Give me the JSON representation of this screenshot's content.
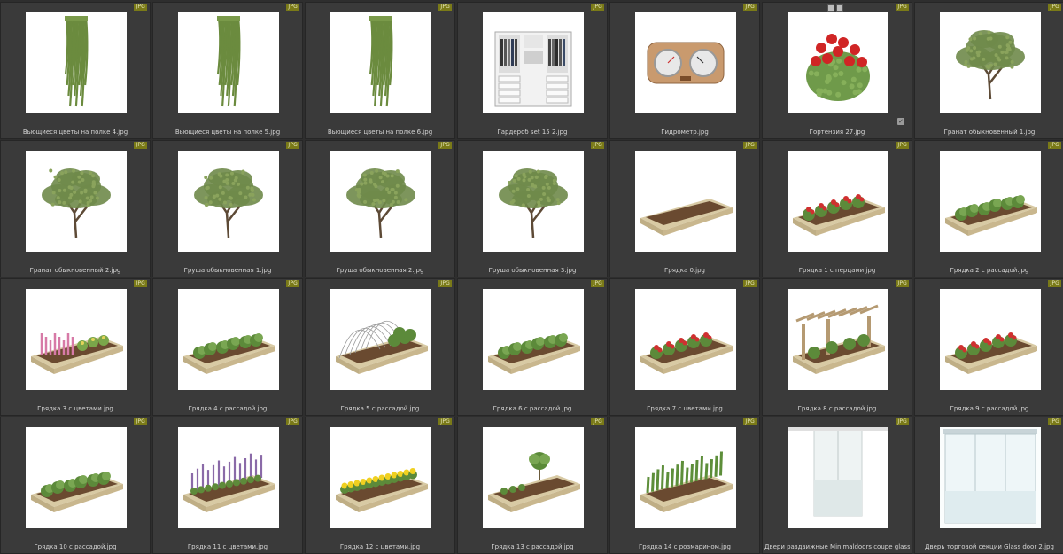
{
  "colors": {
    "background": "#2e2e2e",
    "cell": "#3a3a3a",
    "badge": "#7a7a18",
    "caption": "#d4d4d4"
  },
  "files": [
    {
      "name": "Вьющиеся цветы на полке 4.jpg",
      "badge": "JPG",
      "thumb": "hanging"
    },
    {
      "name": "Вьющиеся цветы на полке 5.jpg",
      "badge": "JPG",
      "thumb": "hanging"
    },
    {
      "name": "Вьющиеся цветы на полке 6.jpg",
      "badge": "JPG",
      "thumb": "hanging"
    },
    {
      "name": "Гардероб set 15 2.jpg",
      "badge": "JPG",
      "thumb": "wardrobe"
    },
    {
      "name": "Гидрометр.jpg",
      "badge": "JPG",
      "thumb": "hygrometer"
    },
    {
      "name": "Гортензия 27.jpg",
      "badge": "JPG",
      "thumb": "roses"
    },
    {
      "name": "Гранат обыкновенный 1.jpg",
      "badge": "JPG",
      "thumb": "tree"
    },
    {
      "name": "Гранат обыкновенный 2.jpg",
      "badge": "JPG",
      "thumb": "tree"
    },
    {
      "name": "Груша обыкновенная 1.jpg",
      "badge": "JPG",
      "thumb": "tree"
    },
    {
      "name": "Груша обыкновенная 2.jpg",
      "badge": "JPG",
      "thumb": "tree"
    },
    {
      "name": "Груша обыкновенная 3.jpg",
      "badge": "JPG",
      "thumb": "tree"
    },
    {
      "name": "Грядка 0.jpg",
      "badge": "JPG",
      "thumb": "bed-empty"
    },
    {
      "name": "Грядка 1 с перцами.jpg",
      "badge": "JPG",
      "thumb": "bed-red"
    },
    {
      "name": "Грядка 2 с рассадой.jpg",
      "badge": "JPG",
      "thumb": "bed-green"
    },
    {
      "name": "Грядка 3 с цветами.jpg",
      "badge": "JPG",
      "thumb": "bed-pink"
    },
    {
      "name": "Грядка 4 с рассадой.jpg",
      "badge": "JPG",
      "thumb": "bed-green"
    },
    {
      "name": "Грядка 5 с рассадой.jpg",
      "badge": "JPG",
      "thumb": "bed-arch"
    },
    {
      "name": "Грядка 6 с рассадой.jpg",
      "badge": "JPG",
      "thumb": "bed-green"
    },
    {
      "name": "Грядка 7 с цветами.jpg",
      "badge": "JPG",
      "thumb": "bed-red"
    },
    {
      "name": "Грядка 8 с рассадой.jpg",
      "badge": "JPG",
      "thumb": "bed-pergola"
    },
    {
      "name": "Грядка 9 с рассадой.jpg",
      "badge": "JPG",
      "thumb": "bed-red"
    },
    {
      "name": "Грядка 10 с рассадой.jpg",
      "badge": "JPG",
      "thumb": "bed-green"
    },
    {
      "name": "Грядка 11 с цветами.jpg",
      "badge": "JPG",
      "thumb": "bed-purple"
    },
    {
      "name": "Грядка 12 с цветами.jpg",
      "badge": "JPG",
      "thumb": "bed-yellow"
    },
    {
      "name": "Грядка 13 с рассадой.jpg",
      "badge": "JPG",
      "thumb": "bed-shrub"
    },
    {
      "name": "Грядка 14 с розмарином.jpg",
      "badge": "JPG",
      "thumb": "bed-tall"
    },
    {
      "name": "Двери раздвижные Minimaldoors coupe glass.jpg",
      "badge": "JPG",
      "thumb": "door"
    },
    {
      "name": "Дверь торговой секции Glass door 2.jpg",
      "badge": "JPG",
      "thumb": "glassdoor"
    }
  ]
}
